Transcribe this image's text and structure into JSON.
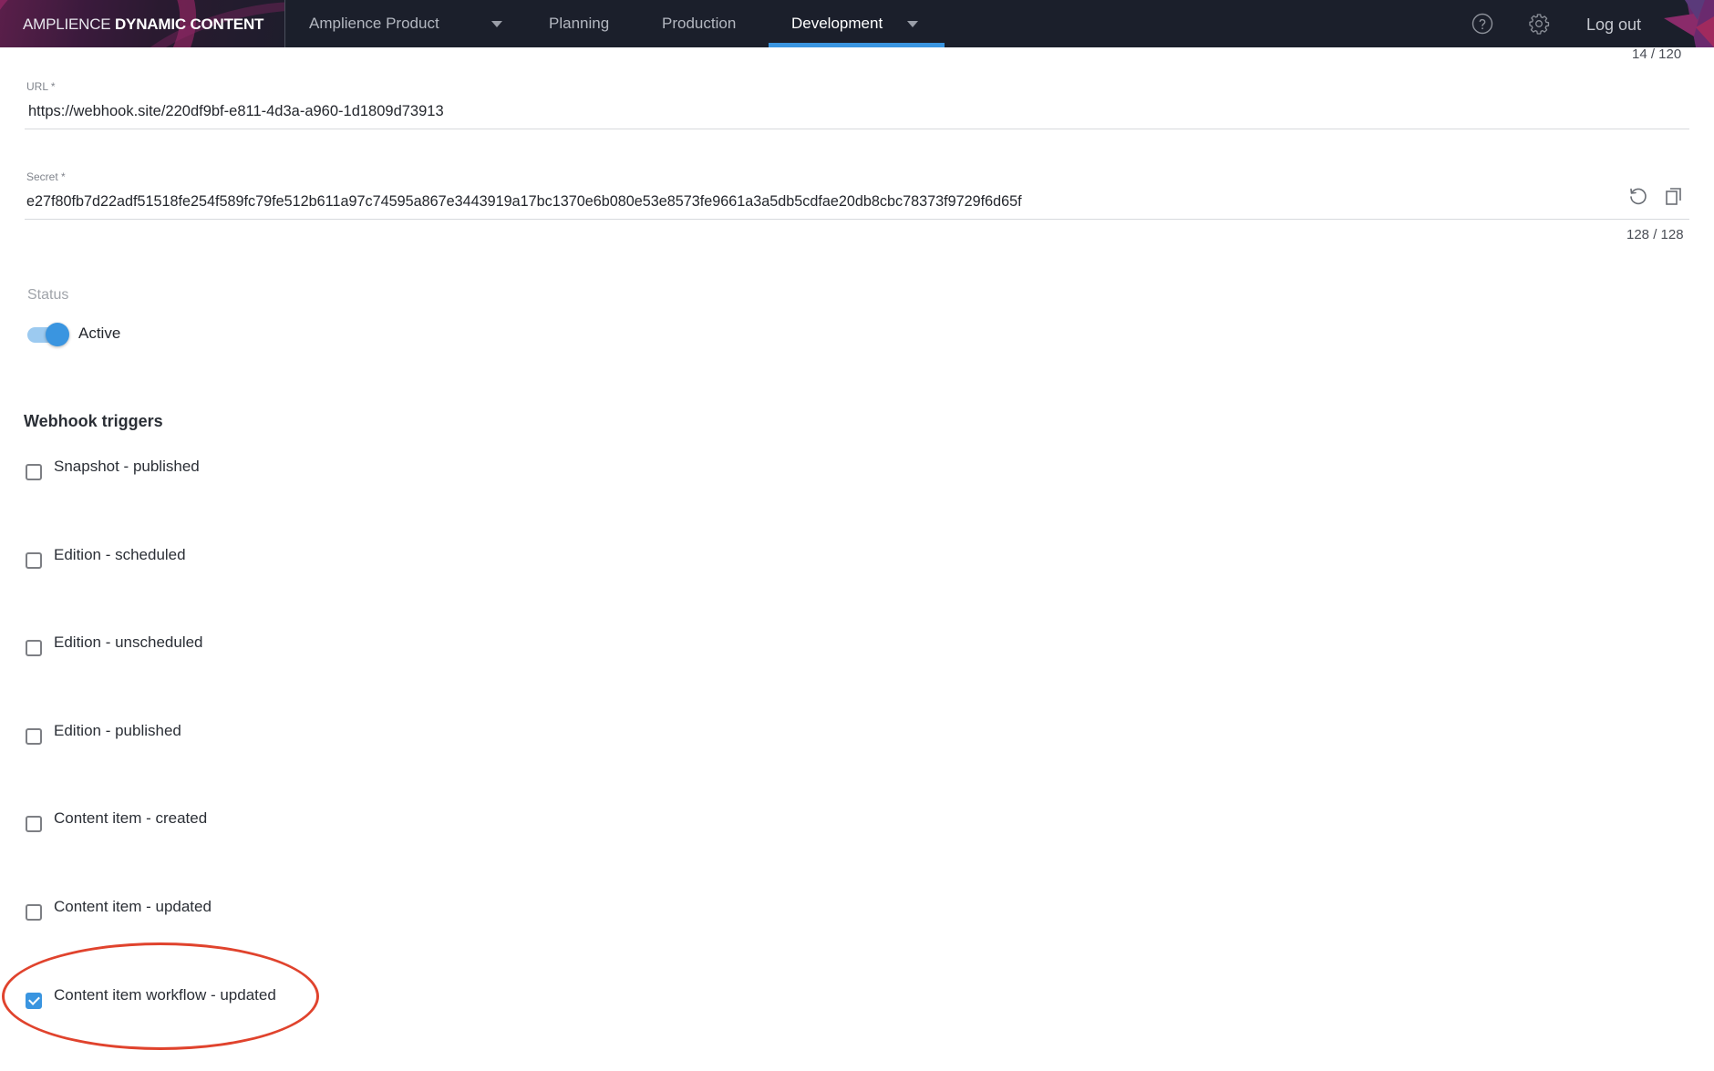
{
  "header": {
    "brand_light": "AMPLIENCE",
    "brand_bold": "DYNAMIC CONTENT",
    "hub_selector": "Amplience Product",
    "nav": [
      {
        "label": "Planning",
        "active": false
      },
      {
        "label": "Production",
        "active": false
      },
      {
        "label": "Development",
        "active": true
      }
    ],
    "help_icon": "help-circle-icon",
    "settings_icon": "gear-icon",
    "logout_label": "Log out",
    "accent_color": "#3a95e0"
  },
  "form": {
    "name_counter": "14 / 120",
    "url": {
      "label": "URL *",
      "value": "https://webhook.site/220df9bf-e811-4d3a-a960-1d1809d73913"
    },
    "secret": {
      "label": "Secret *",
      "value": "e27f80fb7d22adf51518fe254f589fc79fe512b611a97c74595a867e3443919a17bc1370e6b080e53e8573fe9661a3a5db5cdfae20db8cbc78373f9729f6d65f",
      "counter": "128 / 128",
      "regenerate_icon": "refresh-icon",
      "copy_icon": "copy-icon"
    },
    "status": {
      "label": "Status",
      "toggle_label": "Active",
      "enabled": true
    },
    "triggers": {
      "title": "Webhook triggers",
      "items": [
        {
          "label": "Snapshot - published",
          "checked": false
        },
        {
          "label": "Edition - scheduled",
          "checked": false
        },
        {
          "label": "Edition - unscheduled",
          "checked": false
        },
        {
          "label": "Edition - published",
          "checked": false
        },
        {
          "label": "Content item - created",
          "checked": false
        },
        {
          "label": "Content item - updated",
          "checked": false
        },
        {
          "label": "Content item workflow - updated",
          "checked": true
        }
      ]
    }
  },
  "annotation": {
    "color": "#e0432d",
    "highlights": "Content item workflow - updated"
  }
}
